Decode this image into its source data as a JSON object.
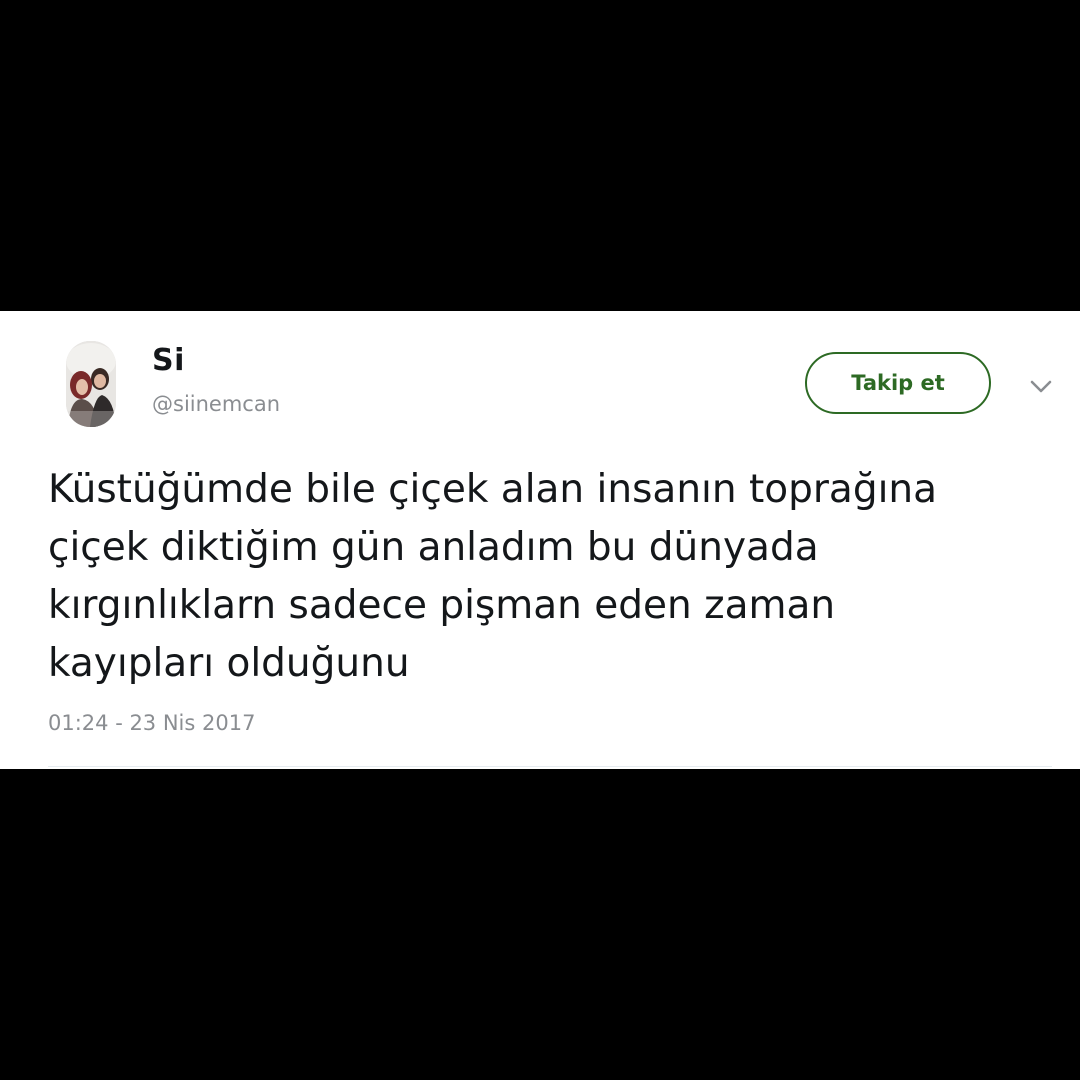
{
  "tweet": {
    "display_name": "Si",
    "handle": "@siinemcan",
    "follow_label": "Takip et",
    "text": "Küstüğümde bile çiçek alan insanın toprağına\nçiçek diktiğim gün anladım bu dünyada\nkırgınlıklarn sadece pişman eden zaman\nkayıpları olduğunu",
    "timestamp": "01:24 - 23 Nis 2017"
  },
  "icons": {
    "menu": "chevron-down-icon",
    "avatar": "profile-photo"
  },
  "colors": {
    "background": "#000000",
    "card": "#ffffff",
    "accent": "#2d6a24",
    "text": "#14171a",
    "muted": "#8a8d91"
  }
}
